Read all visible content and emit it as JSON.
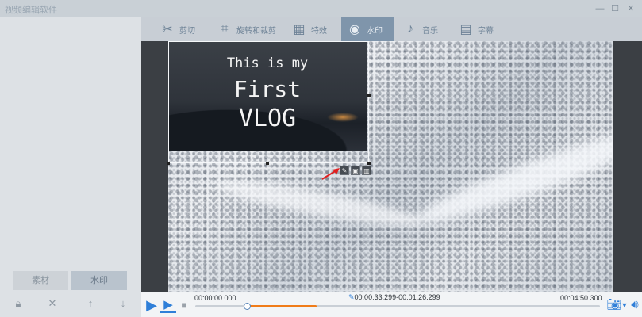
{
  "window": {
    "title": "视频编辑软件",
    "controls": {
      "minimize": "—",
      "maximize": "☐",
      "close": "✕"
    }
  },
  "toolbar": {
    "items": [
      {
        "label": "剪切",
        "icon": "film-reel-icon",
        "glyph": "✂"
      },
      {
        "label": "旋转和裁剪",
        "icon": "crop-icon",
        "glyph": "⌗"
      },
      {
        "label": "特效",
        "icon": "effects-icon",
        "glyph": "▦"
      },
      {
        "label": "水印",
        "icon": "watermark-reel-icon",
        "glyph": "◉",
        "active": true
      },
      {
        "label": "音乐",
        "icon": "music-note-icon",
        "glyph": "♪"
      },
      {
        "label": "字幕",
        "icon": "subtitle-icon",
        "glyph": "▤"
      }
    ]
  },
  "left_panel": {
    "tabs": [
      {
        "label": "素材"
      },
      {
        "label": "水印",
        "active": true
      }
    ],
    "icons": [
      "lock-icon",
      "close-icon",
      "arrow-up-icon",
      "arrow-down-icon"
    ]
  },
  "watermark": {
    "lines": [
      "This is my",
      "First",
      "VLOG"
    ],
    "tools": [
      {
        "icon": "edit-pencil-icon",
        "glyph": "✎"
      },
      {
        "icon": "image-icon",
        "glyph": "▣"
      },
      {
        "icon": "delete-icon",
        "glyph": "▥"
      }
    ]
  },
  "playback": {
    "current_time": "00:00:00.000",
    "clip_range": "00:00:33.299-00:01:26.299",
    "total_time": "00:04:50.300",
    "progress_fraction": 0.128,
    "clip_start_fraction": 0.128,
    "clip_end_fraction": 0.3
  },
  "colors": {
    "accent_blue": "#2f7fd8",
    "progress_orange": "#f07c19",
    "active_tab": "#7f95ab"
  }
}
